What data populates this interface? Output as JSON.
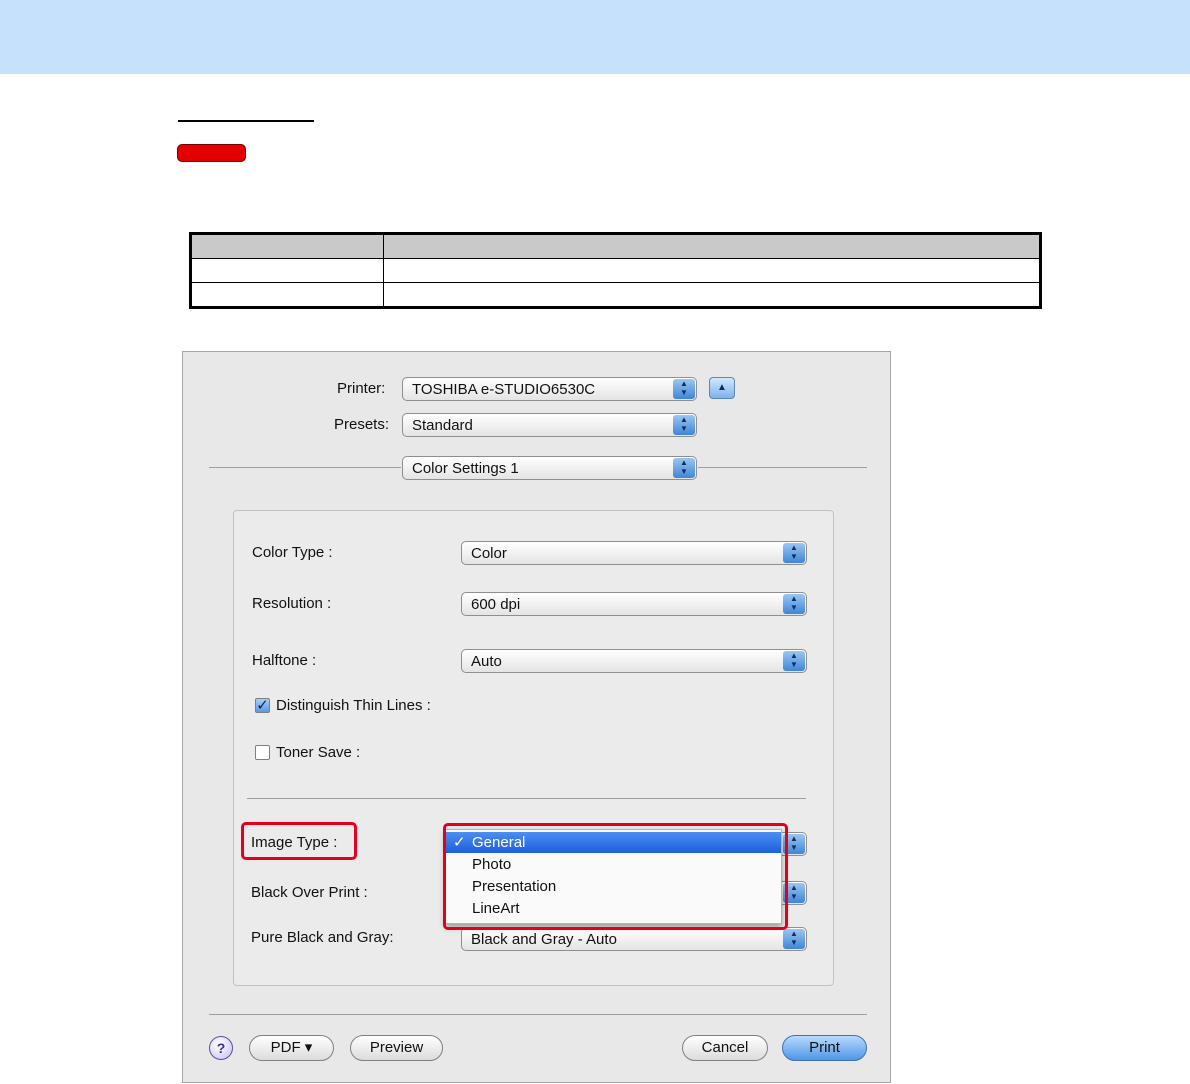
{
  "colors": {
    "banner": "#c5e1fb",
    "accent_red": "#e30000",
    "selection_blue": "#2f74e6"
  },
  "dialog": {
    "printer": {
      "label": "Printer:",
      "value": "TOSHIBA e-STUDIO6530C"
    },
    "presets": {
      "label": "Presets:",
      "value": "Standard"
    },
    "pane": {
      "value": "Color Settings 1"
    },
    "settings": {
      "color_type": {
        "label": "Color Type :",
        "value": "Color"
      },
      "resolution": {
        "label": "Resolution :",
        "value": "600 dpi"
      },
      "halftone": {
        "label": "Halftone :",
        "value": "Auto"
      },
      "thin_lines": {
        "label": "Distinguish Thin Lines :",
        "checked": true
      },
      "toner_save": {
        "label": "Toner Save :",
        "checked": false
      },
      "image_type": {
        "label": "Image Type :"
      },
      "black_over_print": {
        "label": "Black Over Print :"
      },
      "pure_black": {
        "label": "Pure Black and Gray:",
        "value": "Black and Gray - Auto"
      }
    },
    "image_type_menu": {
      "checkmark": "✓",
      "selected": "General",
      "options": [
        "General",
        "Photo",
        "Presentation",
        "LineArt"
      ]
    },
    "buttons": {
      "help": "?",
      "pdf": "PDF ▾",
      "preview": "Preview",
      "cancel": "Cancel",
      "print": "Print"
    },
    "icons": {
      "stepper": "up-down-arrows-icon",
      "collapse": "triangle-up-icon",
      "check": "checkmark-icon"
    }
  }
}
